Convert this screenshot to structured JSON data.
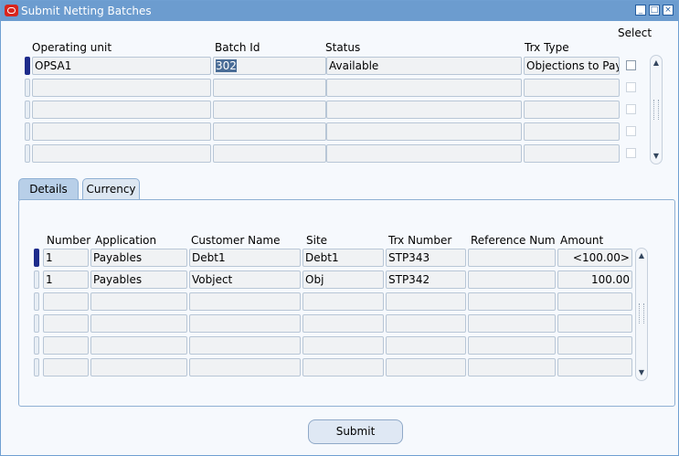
{
  "window": {
    "title": "Submit Netting Batches"
  },
  "batches": {
    "headers": {
      "operating_unit": "Operating unit",
      "batch_id": "Batch Id",
      "status": "Status",
      "trx_type": "Trx Type",
      "select": "Select"
    },
    "rows": [
      {
        "operating_unit": "OPSA1",
        "batch_id": "302",
        "status": "Available",
        "trx_type": "Objections to Pay",
        "select": false
      },
      {
        "operating_unit": "",
        "batch_id": "",
        "status": "",
        "trx_type": "",
        "select": false
      },
      {
        "operating_unit": "",
        "batch_id": "",
        "status": "",
        "trx_type": "",
        "select": false
      },
      {
        "operating_unit": "",
        "batch_id": "",
        "status": "",
        "trx_type": "",
        "select": false
      },
      {
        "operating_unit": "",
        "batch_id": "",
        "status": "",
        "trx_type": "",
        "select": false
      }
    ]
  },
  "tabs": [
    {
      "label": "Details",
      "active": true
    },
    {
      "label": "Currency",
      "active": false
    }
  ],
  "details": {
    "headers": {
      "number": "Number",
      "application": "Application",
      "customer_name": "Customer Name",
      "site": "Site",
      "trx_number": "Trx Number",
      "reference_num": "Reference Num",
      "amount": "Amount"
    },
    "rows": [
      {
        "number": "1",
        "application": "Payables",
        "customer_name": "Debt1",
        "site": "Debt1",
        "trx_number": "STP343",
        "reference_num": "",
        "amount": "<100.00>"
      },
      {
        "number": "1",
        "application": "Payables",
        "customer_name": "Vobject",
        "site": "Obj",
        "trx_number": "STP342",
        "reference_num": "",
        "amount": "100.00"
      },
      {
        "number": "",
        "application": "",
        "customer_name": "",
        "site": "",
        "trx_number": "",
        "reference_num": "",
        "amount": ""
      },
      {
        "number": "",
        "application": "",
        "customer_name": "",
        "site": "",
        "trx_number": "",
        "reference_num": "",
        "amount": ""
      },
      {
        "number": "",
        "application": "",
        "customer_name": "",
        "site": "",
        "trx_number": "",
        "reference_num": "",
        "amount": ""
      },
      {
        "number": "",
        "application": "",
        "customer_name": "",
        "site": "",
        "trx_number": "",
        "reference_num": "",
        "amount": ""
      }
    ]
  },
  "actions": {
    "submit": "Submit"
  }
}
